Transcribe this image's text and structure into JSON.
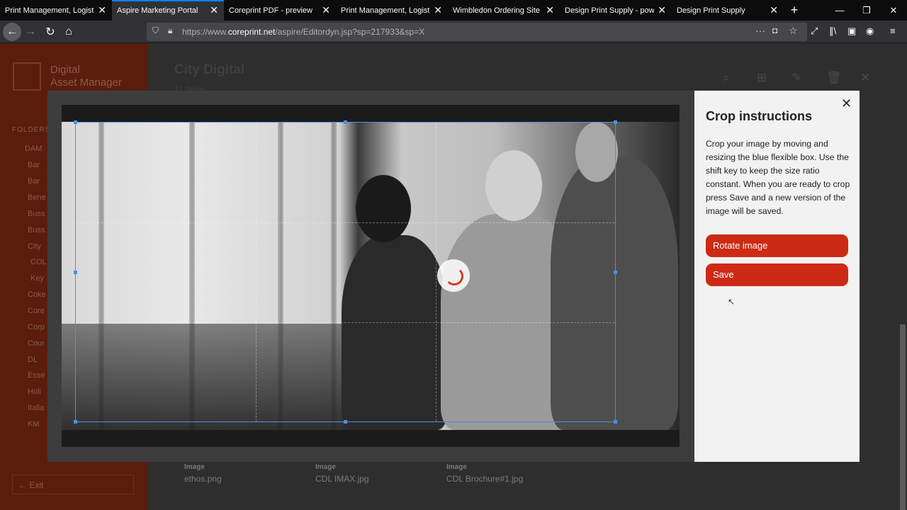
{
  "browser": {
    "tabs": [
      {
        "title": "Print Management, Logistics"
      },
      {
        "title": "Aspire Marketing Portal"
      },
      {
        "title": "Coreprint PDF - preview"
      },
      {
        "title": "Print Management, Logistics"
      },
      {
        "title": "Wimbledon Ordering Site"
      },
      {
        "title": "Design Print Supply - powered"
      },
      {
        "title": "Design Print Supply"
      }
    ],
    "active_tab": 1,
    "new_tab": "+",
    "url_prefix": "https://www.",
    "url_domain": "coreprint.net",
    "url_path": "/aspire/Editordyn.jsp?sp=217933&sp=X"
  },
  "sidebar": {
    "app_name_line1": "Digital",
    "app_name_line2": "Asset Manager",
    "folders_label": "FOLDERS",
    "items": [
      "DAM",
      "Bar",
      "Bar",
      "Bene",
      "Buss",
      "Buss",
      "City",
      "COL",
      "Key",
      "Coke",
      "Core",
      "Corp",
      "Cour",
      "DL",
      "Esse",
      "Holi",
      "Italia",
      "KM"
    ],
    "exit_label": "Exit"
  },
  "main": {
    "title": "City Digital",
    "subtitle": "11 items",
    "files": [
      {
        "label": "Image",
        "name": "ethos.png"
      },
      {
        "label": "Image",
        "name": "CDL IMAX.jpg"
      },
      {
        "label": "Image",
        "name": "CDL Brochure#1.jpg"
      }
    ]
  },
  "crop_panel": {
    "title": "Crop instructions",
    "instructions": "Crop your image by moving and resizing the blue flexible box. Use the shift key to keep the size ratio constant. When you are ready to crop press Save and a new version of the image will be saved.",
    "rotate_label": "Rotate image",
    "save_label": "Save",
    "close_glyph": "✕"
  },
  "colors": {
    "accent": "#cc2a14",
    "crop_border": "#4a90e2",
    "tab_highlight": "#0a84ff"
  }
}
